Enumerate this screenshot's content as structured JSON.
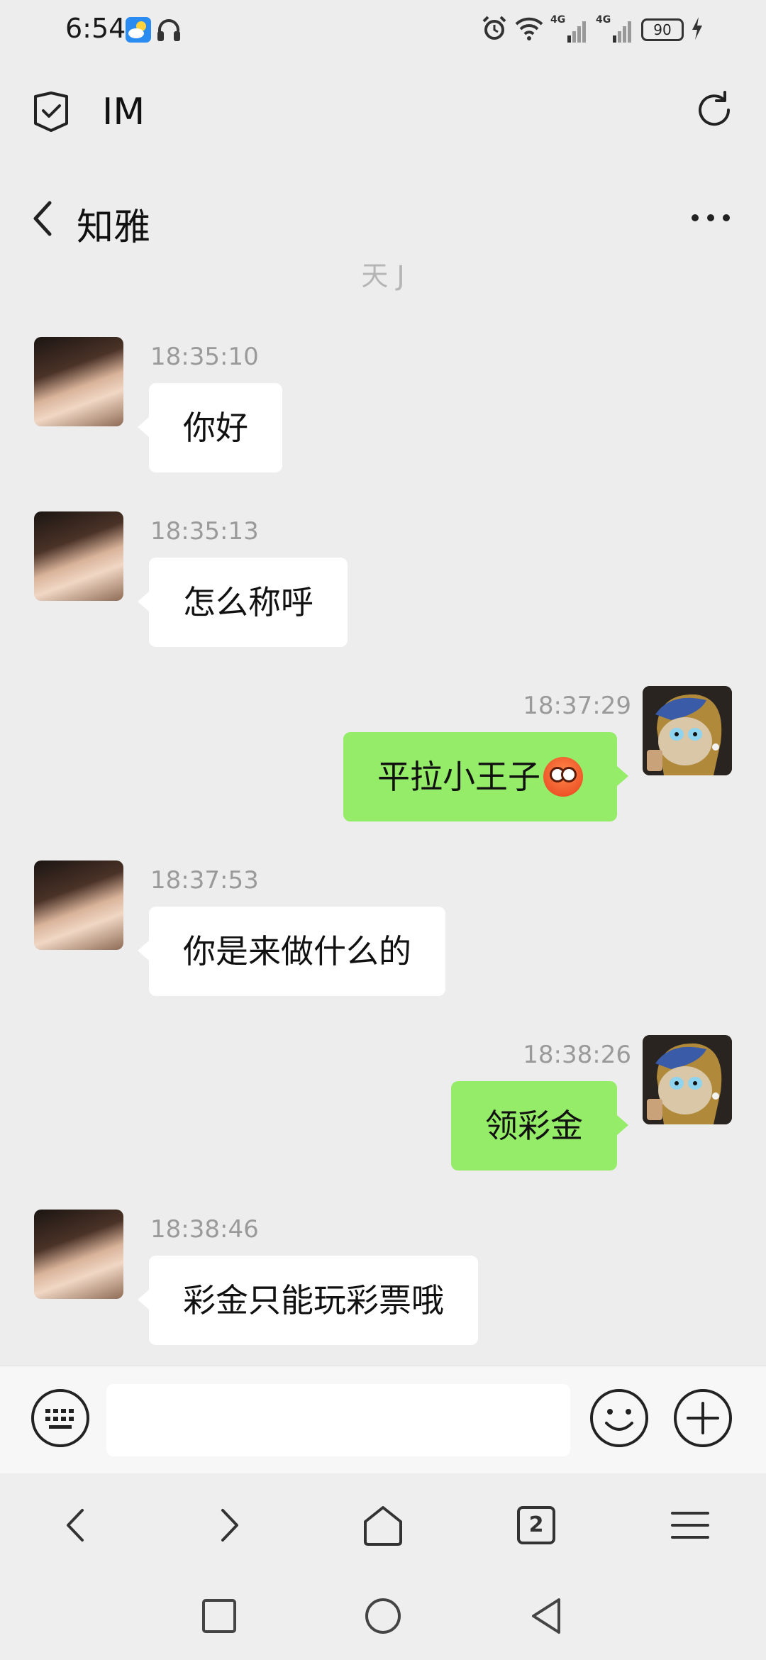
{
  "status_bar": {
    "time": "6:54",
    "signal_tag_1": "4G",
    "signal_tag_2": "4G",
    "battery": "90"
  },
  "app_header": {
    "title": "IM"
  },
  "chat_header": {
    "title": "知雅"
  },
  "messages": {
    "partial_system_text": "天 J",
    "items": [
      {
        "side": "left",
        "time": "18:35:10",
        "text": "你好"
      },
      {
        "side": "left",
        "time": "18:35:13",
        "text": "怎么称呼"
      },
      {
        "side": "right",
        "time": "18:37:29",
        "text": "平拉小王子",
        "emoji": "flushed-face-emoji"
      },
      {
        "side": "left",
        "time": "18:37:53",
        "text": "你是来做什么的"
      },
      {
        "side": "right",
        "time": "18:38:26",
        "text": "领彩金"
      },
      {
        "side": "left",
        "time": "18:38:46",
        "text": "彩金只能玩彩票哦"
      }
    ]
  },
  "input_bar": {
    "value": "",
    "placeholder": ""
  },
  "browser_nav": {
    "tab_count": "2"
  },
  "colors": {
    "background": "#ededed",
    "sent_bubble": "#95ec69",
    "received_bubble": "#ffffff",
    "timestamp": "#9a9a9a"
  },
  "icons": [
    "weather-icon",
    "headphone-icon",
    "alarm-icon",
    "wifi-icon",
    "signal-icon",
    "battery-icon",
    "charging-icon",
    "shield-check-icon",
    "refresh-icon",
    "back-chevron-icon",
    "more-dots-icon",
    "keyboard-icon",
    "smiley-icon",
    "plus-circle-icon",
    "browser-back-icon",
    "browser-forward-icon",
    "home-icon",
    "tabs-icon",
    "menu-icon",
    "recents-icon",
    "home-circle-icon",
    "back-triangle-icon"
  ]
}
